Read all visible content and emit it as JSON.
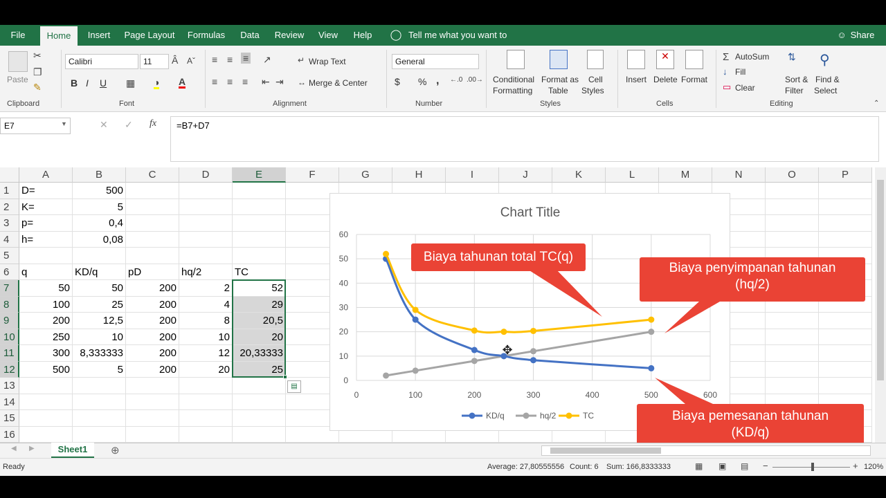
{
  "tabs": [
    "File",
    "Home",
    "Insert",
    "Page Layout",
    "Formulas",
    "Data",
    "Review",
    "View",
    "Help"
  ],
  "tell_me": "Tell me what you want to do",
  "share": "Share",
  "clipboard": {
    "paste": "Paste",
    "label": "Clipboard"
  },
  "font": {
    "name": "Calibri",
    "size": "11",
    "label": "Font",
    "bold": "B",
    "italic": "I",
    "underline": "U"
  },
  "alignment": {
    "wrap": "Wrap Text",
    "merge": "Merge & Center",
    "label": "Alignment"
  },
  "number": {
    "format": "General",
    "label": "Number",
    "currency": "$",
    "percent": "%",
    "comma": ","
  },
  "styles": {
    "conditional1": "Conditional",
    "conditional2": "Formatting",
    "format_as1": "Format as",
    "format_as2": "Table",
    "cell_styles1": "Cell",
    "cell_styles2": "Styles",
    "label": "Styles"
  },
  "cells": {
    "insert": "Insert",
    "delete": "Delete",
    "format": "Format",
    "label": "Cells"
  },
  "editing": {
    "autosum": "AutoSum",
    "fill": "Fill",
    "clear": "Clear",
    "sort1": "Sort &",
    "sort2": "Filter",
    "find1": "Find &",
    "find2": "Select",
    "label": "Editing"
  },
  "formula_bar": {
    "name_box": "E7",
    "formula": "=B7+D7",
    "fx": "fx"
  },
  "columns": [
    "A",
    "B",
    "C",
    "D",
    "E",
    "F",
    "G",
    "H",
    "I",
    "J",
    "K",
    "L",
    "M",
    "N",
    "O",
    "P"
  ],
  "rows": [
    "1",
    "2",
    "3",
    "4",
    "5",
    "6",
    "7",
    "8",
    "9",
    "10",
    "11",
    "12",
    "13",
    "14",
    "15",
    "16"
  ],
  "cells_data": {
    "r1": [
      "D=",
      "500"
    ],
    "r2": [
      "K=",
      "5"
    ],
    "r3": [
      "p=",
      "0,4"
    ],
    "r4": [
      "h=",
      "0,08"
    ],
    "r6": [
      "q",
      "KD/q",
      "pD",
      "hq/2",
      "TC"
    ],
    "table": [
      [
        "50",
        "50",
        "200",
        "2",
        "52"
      ],
      [
        "100",
        "25",
        "200",
        "4",
        "29"
      ],
      [
        "200",
        "12,5",
        "200",
        "8",
        "20,5"
      ],
      [
        "250",
        "10",
        "200",
        "10",
        "20"
      ],
      [
        "300",
        "8,333333",
        "200",
        "12",
        "20,33333"
      ],
      [
        "500",
        "5",
        "200",
        "20",
        "25"
      ]
    ]
  },
  "chart_data": {
    "type": "line",
    "title": "Chart Title",
    "x": [
      50,
      100,
      200,
      250,
      300,
      500
    ],
    "series": [
      {
        "name": "KD/q",
        "color": "#4472c4",
        "values": [
          50,
          25,
          12.5,
          10,
          8.333333,
          5
        ]
      },
      {
        "name": "hq/2",
        "color": "#a5a5a5",
        "values": [
          2,
          4,
          8,
          10,
          12,
          20
        ]
      },
      {
        "name": "TC",
        "color": "#ffc000",
        "values": [
          52,
          29,
          20.5,
          20,
          20.33333,
          25
        ]
      }
    ],
    "xlim": [
      0,
      600
    ],
    "ylim": [
      0,
      60
    ],
    "xticks": [
      "0",
      "100",
      "200",
      "300",
      "400",
      "500",
      "600"
    ],
    "yticks": [
      "0",
      "10",
      "20",
      "30",
      "40",
      "50",
      "60"
    ],
    "grid": true,
    "legend": "bottom"
  },
  "callouts": {
    "tc": "Biaya tahunan total TC(q)",
    "storage": "Biaya penyimpanan tahunan (hq/2)",
    "ordering": "Biaya pemesanan tahunan (KD/q)"
  },
  "sheet_tab": "Sheet1",
  "status": {
    "ready": "Ready",
    "average": "Average: 27,80555556",
    "count": "Count: 6",
    "sum": "Sum: 166,8333333",
    "zoom": "120%"
  }
}
